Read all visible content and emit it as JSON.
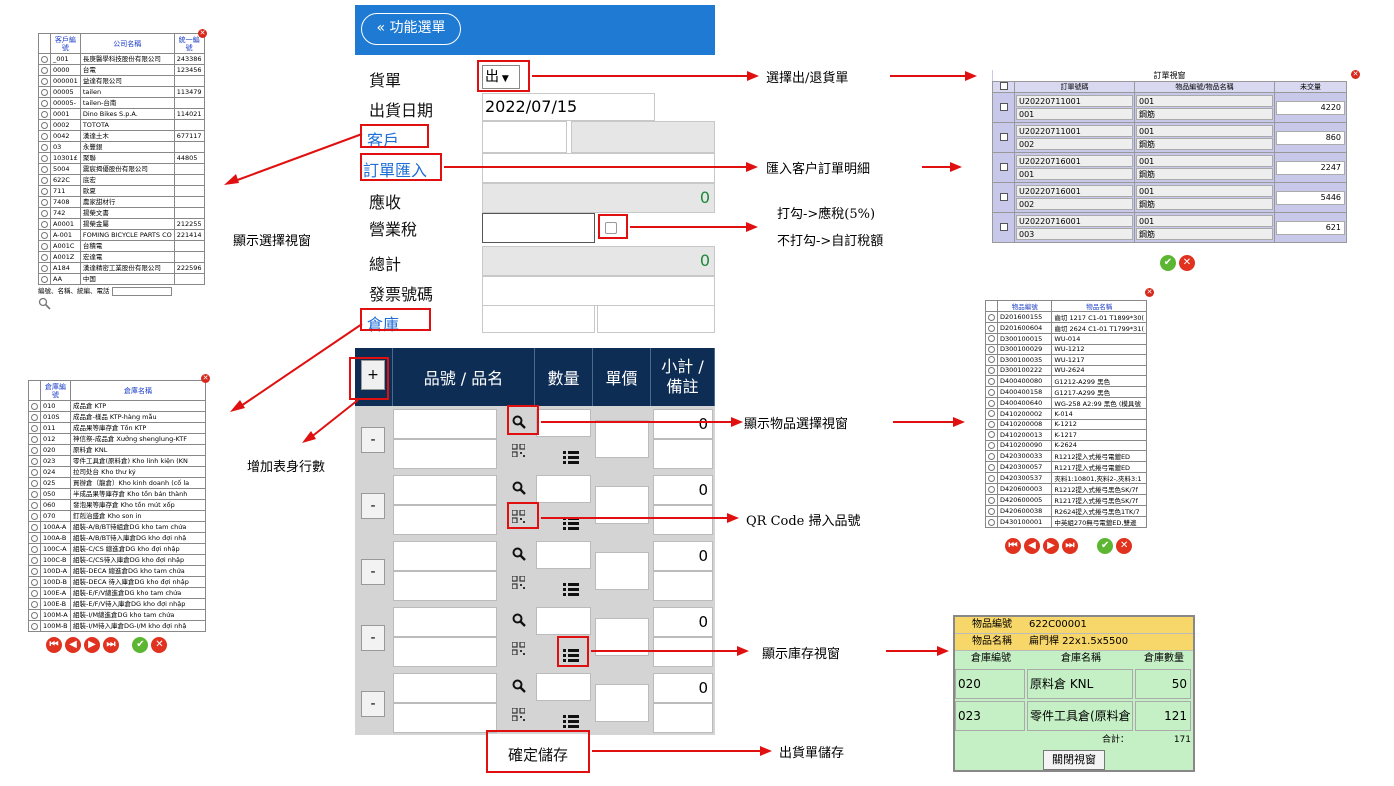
{
  "form": {
    "menu_label": "« 功能選單",
    "doc_label": "貨單",
    "doc_type_value": "出",
    "date_label": "出貨日期",
    "date_value": "2022/07/15",
    "customer_label": "客戶",
    "order_import_label": "訂單匯入",
    "receivable_label": "應收",
    "receivable_value": "0",
    "tax_label": "營業稅",
    "total_label": "總計",
    "total_value": "0",
    "invoice_label": "發票號碼",
    "warehouse_label": "倉庫",
    "add_row_label": "+",
    "col_item": "品號 / 品名",
    "col_qty": "數量",
    "col_price": "單價",
    "col_subtotal": "小計 / 備註",
    "remove_label": "-",
    "row_subtotals": [
      "0",
      "0",
      "0",
      "0",
      "0"
    ],
    "save_label": "確定儲存"
  },
  "annotations": {
    "select_doc": "選擇出/退貨單",
    "import_order": "匯入客户訂單明細",
    "tax_checked": "打勾->應稅(5%)",
    "tax_unchecked": "不打勾->自訂稅額",
    "show_select_window": "顯示選擇視窗",
    "add_row": "增加表身行數",
    "show_item_window": "顯示物品選擇視窗",
    "qr_scan": "QR Code 掃入品號",
    "show_stock_window": "顯示庫存視窗",
    "save_doc": "出貨單儲存"
  },
  "customer_window": {
    "headers": [
      "客戶編號",
      "公司名稱",
      "統一編號"
    ],
    "rows": [
      [
        "_001",
        "長庚醫學科技股份有限公司",
        "243386"
      ],
      [
        "0000",
        "台電",
        "123456"
      ],
      [
        "000001",
        "益達有限公司",
        ""
      ],
      [
        "00005",
        "tailen",
        "113479"
      ],
      [
        "00005-",
        "tailen-台南",
        ""
      ],
      [
        "0001",
        "Dino Bikes S.p.A.",
        "114021"
      ],
      [
        "0002",
        "TOTOTA",
        ""
      ],
      [
        "0042",
        "漢達土木",
        "677117"
      ],
      [
        "03",
        "永豐銀",
        ""
      ],
      [
        "10301£",
        "聚聯",
        "44805"
      ],
      [
        "5004",
        "震宸揭優股份有限公司",
        ""
      ],
      [
        "622C",
        "底宏",
        ""
      ],
      [
        "711",
        "歐夏",
        ""
      ],
      [
        "7408",
        "農家甜材行",
        ""
      ],
      [
        "742",
        "揚榮文書",
        ""
      ],
      [
        "A0001",
        "揚榮金屬",
        "212255"
      ],
      [
        "A-001",
        "FOMING BICYCLE PARTS CO",
        "221414"
      ],
      [
        "A001C",
        "台積電",
        ""
      ],
      [
        "A001Z",
        "宏達電",
        ""
      ],
      [
        "A184",
        "漢達精密工業股份有限公司",
        "222596"
      ],
      [
        "AA",
        "中国",
        ""
      ]
    ],
    "search_hint": "編號、名稱、統編、電話"
  },
  "warehouse_window": {
    "headers": [
      "倉庫編號",
      "倉庫名稱"
    ],
    "rows": [
      [
        "010",
        "成品倉 KTP"
      ],
      [
        "010S",
        "成品倉-樣品 KTP-hàng mẫu"
      ],
      [
        "011",
        "成品果等庫存倉 Tồn KTP"
      ],
      [
        "012",
        "神信祭-成品倉 Xưởng shenglung-KTF"
      ],
      [
        "020",
        "原料倉 KNL"
      ],
      [
        "023",
        "零件工具倉(原料倉) Kho linh kiện (KN"
      ],
      [
        "024",
        "拉司处台 Kho thư ký"
      ],
      [
        "025",
        "買辦倉（龍倉）Kho kinh doanh (cố la"
      ],
      [
        "050",
        "半成品果等庫存倉 Kho tồn bán thành"
      ],
      [
        "060",
        "發泡果等庫存倉 Kho tồn mút xốp"
      ],
      [
        "070",
        "釘剋治盛倉 Kho son in"
      ],
      [
        "100A-A",
        "組裝-A/B/BT待組倉DG kho tam chứa"
      ],
      [
        "100A-B",
        "組裝-A/B/BT待入庫倉DG kho đợi nhậ"
      ],
      [
        "100C-A",
        "組裝-C/CS 總進倉DG kho đợi nhập"
      ],
      [
        "100C-B",
        "組裝-C/CS待入庫倉DG kho đợi nhập"
      ],
      [
        "100D-A",
        "組裝-DECA 總進倉DG kho tam chứa"
      ],
      [
        "100D-B",
        "組裝-DECA 待入庫倉DG kho đợi nhập"
      ],
      [
        "100E-A",
        "組裝-E/F/V總進倉DG kho tam chứa"
      ],
      [
        "100E-B",
        "組裝-E/F/V待入庫倉DG kho đợi nhập"
      ],
      [
        "100M-A",
        "組裝-I/M總進倉DG kho tam chứa"
      ],
      [
        "100M-B",
        "組裝-I/M待入庫倉DG-I/M kho đợi nhậ"
      ]
    ]
  },
  "order_window": {
    "title": "訂單視窗",
    "headers": [
      "訂單號碼",
      "物品編號/物品名稱",
      "未交量"
    ],
    "rows": [
      {
        "order": "U20220711001",
        "seq": "001",
        "item": "001",
        "name": "鋼筋",
        "qty": "4220"
      },
      {
        "order": "U20220711001",
        "seq": "002",
        "item": "001",
        "name": "鋼筋",
        "qty": "860"
      },
      {
        "order": "U20220716001",
        "seq": "001",
        "item": "001",
        "name": "鋼筋",
        "qty": "2247"
      },
      {
        "order": "U20220716001",
        "seq": "002",
        "item": "001",
        "name": "鋼筋",
        "qty": "5446"
      },
      {
        "order": "U20220716001",
        "seq": "003",
        "item": "001",
        "name": "鋼筋",
        "qty": "621"
      }
    ]
  },
  "item_window": {
    "headers": [
      "物品編號",
      "物品名稱"
    ],
    "rows": [
      [
        "D201600155",
        "齒切 1217 C1-01 T1899*30("
      ],
      [
        "D201600604",
        "齒切 2624 C1-01 T1799*31("
      ],
      [
        "D300100015",
        "WU-014"
      ],
      [
        "D300100029",
        "WU-1212"
      ],
      [
        "D300100035",
        "WU-1217"
      ],
      [
        "D300100222",
        "WU-2624"
      ],
      [
        "D400400080",
        "G1212-A299 黑色"
      ],
      [
        "D400400158",
        "G1217-A299 黑色"
      ],
      [
        "D400400640",
        "WG-258 A2:99 黑色 (模具號"
      ],
      [
        "D410200002",
        "K-014"
      ],
      [
        "D410200008",
        "K-1212"
      ],
      [
        "D410200013",
        "K-1217"
      ],
      [
        "D410200090",
        "K-2624"
      ],
      [
        "D420300033",
        "R1212提入式捲弓電鍍ED"
      ],
      [
        "D420300057",
        "R1217提入式捲弓電鍍ED"
      ],
      [
        "D420300537",
        "夾料1:10801,夾料2-,夾料3:1"
      ],
      [
        "D420600003",
        "R1212提入式捲弓黑色SK/7f"
      ],
      [
        "D420600005",
        "R1217提入式捲弓黑色SK/7f"
      ],
      [
        "D420600038",
        "R2624提入式捲弓黑色1TK/7"
      ],
      [
        "D430100001",
        "中英組270無弓電鍍ED,雙邊"
      ]
    ]
  },
  "stock_window": {
    "item_code_label": "物品編號",
    "item_code": "622C00001",
    "item_name_label": "物品名稱",
    "item_name": "扁門桿 22x1.5x5500",
    "headers": [
      "倉庫編號",
      "倉庫名稱",
      "倉庫數量"
    ],
    "rows": [
      {
        "code": "020",
        "name": "原料倉 KNL",
        "qty": "50"
      },
      {
        "code": "023",
        "name": "零件工具倉(原料倉",
        "qty": "121"
      }
    ],
    "total_label": "合計：",
    "total_value": "171",
    "close_label": "關閉視窗"
  },
  "icons": [
    "search-icon",
    "qr-code-icon",
    "list-icon",
    "close-icon",
    "first-page-icon",
    "prev-page-icon",
    "next-page-icon",
    "last-page-icon",
    "confirm-icon"
  ],
  "colors": {
    "accent": "#1e7ad2",
    "header": "#0e2d55",
    "annotation_red": "#e01010",
    "link_blue": "#1e6ed6"
  }
}
